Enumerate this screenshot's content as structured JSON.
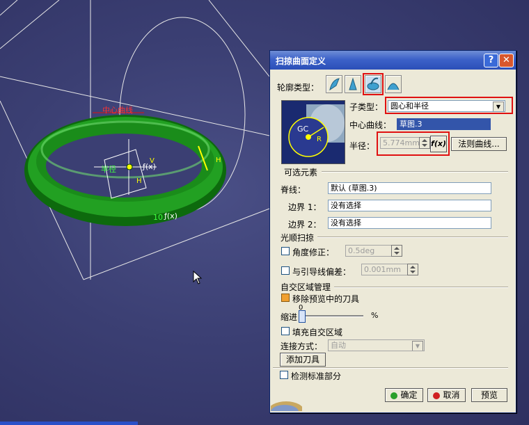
{
  "viewport": {
    "labels": {
      "center_curve": "中心曲线",
      "radius": "半径",
      "fx": "ƒ(x)",
      "ten": "10",
      "v": "V",
      "h": "H"
    }
  },
  "dialog": {
    "title": "扫掠曲面定义",
    "help": "?",
    "close": "✕",
    "profile_type_label": "轮廓类型：",
    "profile_icons": [
      "explicit-profile-icon",
      "line-profile-icon",
      "circle-profile-icon",
      "conic-profile-icon"
    ],
    "subtype_label": "子类型：",
    "subtype_value": "圆心和半径",
    "center_curve_label": "中心曲线：",
    "center_curve_value": "草图.3",
    "preview_gc": "GC",
    "preview_r": "R",
    "radius_label": "半径：",
    "radius_value": "5.774mm",
    "fx_label": "f(x)",
    "law_button": "法则曲线...",
    "optional_section": "可选元素",
    "spine_label": "脊线：",
    "spine_value": "默认 (草图.3)",
    "boundary1_label": "边界 1：",
    "boundary1_value": "没有选择",
    "boundary2_label": "边界 2：",
    "boundary2_value": "没有选择",
    "smooth_section": "光顺扫掠",
    "angle_label": "角度修正：",
    "angle_value": "0.5deg",
    "deviation_label": "与引导线偏差：",
    "deviation_value": "0.001mm",
    "self_section": "自交区域管理",
    "remove_label": "移除预览中的刀具",
    "indent_label": "缩进",
    "indent_value": "0",
    "indent_unit": "%",
    "fill_label": "填充自交区域",
    "connect_label": "连接方式：",
    "connect_value": "自动",
    "add_tool": "添加刀具",
    "check_label": "检测标准部分",
    "ok": "确定",
    "cancel": "取消",
    "preview": "预览"
  },
  "colors": {
    "viewport_bg": "#3b3f73",
    "torus": "#1a8c1a",
    "titlebar": "#3d62c9",
    "highlight": "#e01010"
  }
}
